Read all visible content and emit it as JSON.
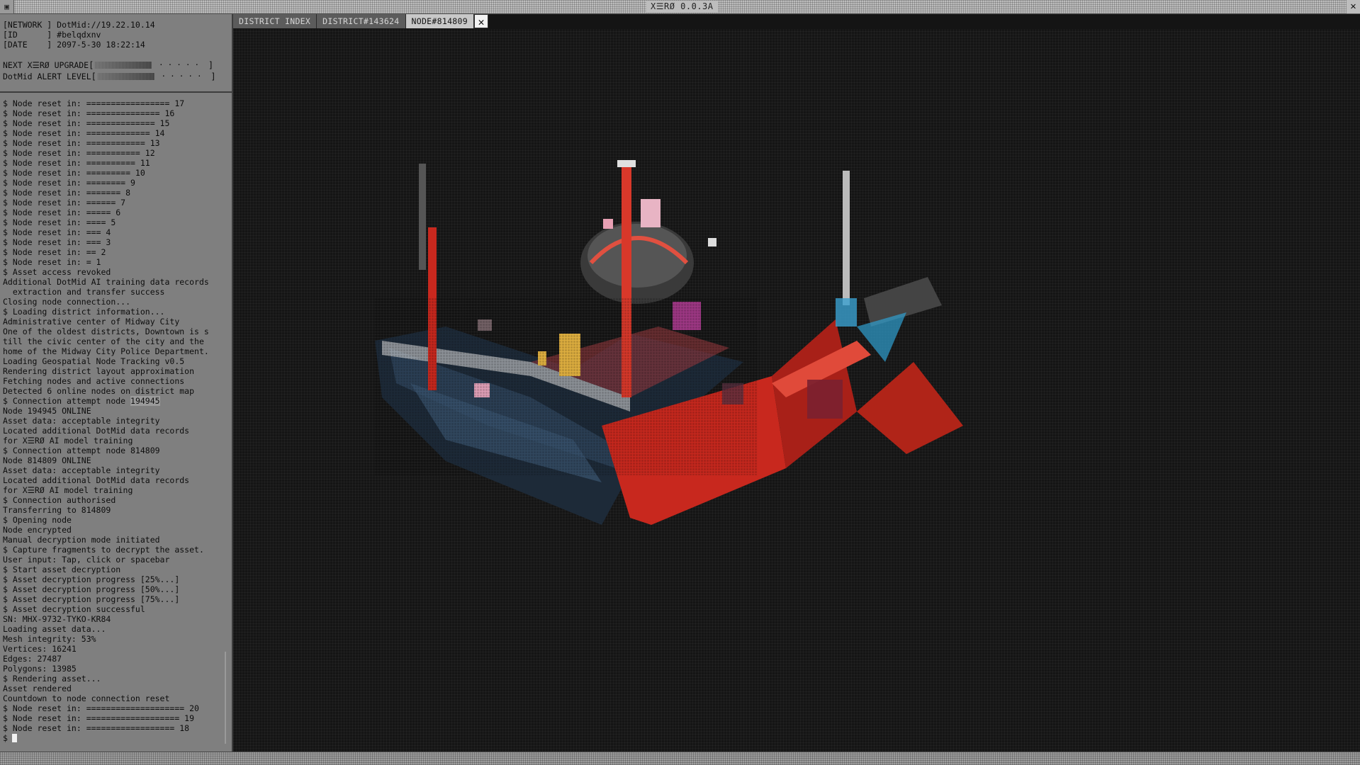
{
  "app": {
    "title": "X☰RØ 0.0.3A",
    "menu_icon": "square-menu-icon",
    "close_glyph": "✕"
  },
  "info": {
    "network": "[NETWORK ] DotMid://19.22.10.14",
    "id": "[ID      ] #belqdxnv",
    "date": "[DATE    ] 2097-5-30 18:22:14",
    "upgrade_label": "NEXT X☰RØ UPGRADE",
    "upgrade_progress": 0.55,
    "alert_label": "DotMid ALERT LEVEL",
    "alert_progress": 0.55
  },
  "log": [
    "$ Node reset in: ================= 17",
    "$ Node reset in: =============== 16",
    "$ Node reset in: ============== 15",
    "$ Node reset in: ============= 14",
    "$ Node reset in: ============ 13",
    "$ Node reset in: =========== 12",
    "$ Node reset in: ========== 11",
    "$ Node reset in: ========= 10",
    "$ Node reset in: ======== 9",
    "$ Node reset in: ======= 8",
    "$ Node reset in: ====== 7",
    "$ Node reset in: ===== 6",
    "$ Node reset in: ==== 5",
    "$ Node reset in: === 4",
    "$ Node reset in: === 3",
    "$ Node reset in: == 2",
    "$ Node reset in: = 1",
    "$ Asset access revoked",
    "Additional DotMid AI training data records",
    "  extraction and transfer success",
    "Closing node connection...",
    "$ Loading district information...",
    "Administrative center of Midway City",
    "One of the oldest districts, Downtown is s",
    "till the civic center of the city and the",
    "home of the Midway City Police Department.",
    "Loading Geospatial Node Tracking v0.5",
    "Rendering district layout approximation",
    "Fetching nodes and active connections",
    "Detected 6 online nodes on district map",
    "$ Connection attempt node ",
    "Node 194945 ONLINE",
    "Asset data: acceptable integrity",
    "Located additional DotMid data records",
    "for X☰RØ AI model training",
    "$ Connection attempt node 814809",
    "Node 814809 ONLINE",
    "Asset data: acceptable integrity",
    "Located additional DotMid data records",
    "for X☰RØ AI model training",
    "$ Connection authorised",
    "Transferring to 814809",
    "$ Opening node",
    "Node encrypted",
    "Manual decryption mode initiated",
    "$ Capture fragments to decrypt the asset.",
    "User input: Tap, click or spacebar",
    "$ Start asset decryption",
    "$ Asset decryption progress [25%...]",
    "$ Asset decryption progress [50%...]",
    "$ Asset decryption progress [75%...]",
    "$ Asset decryption successful",
    "SN: MHX-9732-TYKO-KR84",
    "Loading asset data...",
    "Mesh integrity: 53%",
    "Vertices: 16241",
    "Edges: 27487",
    "Polygons: 13985",
    "$ Rendering asset...",
    "Asset rendered",
    "Countdown to node connection reset",
    "$ Node reset in: ==================== 20",
    "$ Node reset in: =================== 19",
    "$ Node reset in: ================== 18"
  ],
  "log_highlight": "194945",
  "prompt": "$",
  "tabs": [
    {
      "label": "DISTRICT INDEX",
      "active": false
    },
    {
      "label": "DISTRICT#143624",
      "active": false
    },
    {
      "label": "NODE#814809",
      "active": true
    }
  ],
  "tab_close_glyph": "✕",
  "colors": {
    "sidebar_bg": "#7f7f7f",
    "viewport_bg": "#151515",
    "asset_red": "#c8281e",
    "asset_pink": "#e0a0b8",
    "asset_yellow": "#e0b040",
    "asset_cyan": "#40c8e0"
  }
}
